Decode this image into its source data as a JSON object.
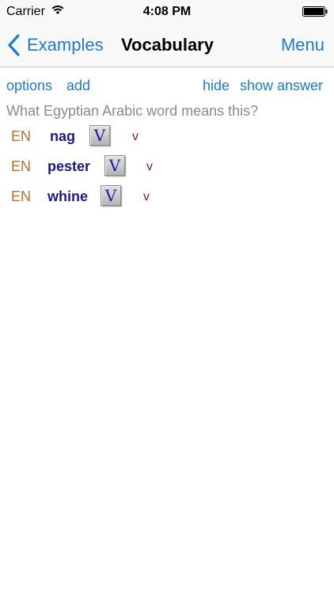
{
  "status_bar": {
    "carrier": "Carrier",
    "time": "4:08 PM"
  },
  "nav": {
    "back_label": "Examples",
    "title": "Vocabulary",
    "menu_label": "Menu"
  },
  "toolbar": {
    "options": "options",
    "add": "add",
    "hide": "hide",
    "show_answer": "show answer"
  },
  "question": "What Egyptian Arabic word means this?",
  "words": [
    {
      "lang": "EN",
      "word": "nag",
      "button": "V",
      "pos": "v"
    },
    {
      "lang": "EN",
      "word": "pester",
      "button": "V",
      "pos": "v"
    },
    {
      "lang": "EN",
      "word": "whine",
      "button": "V",
      "pos": "v"
    }
  ],
  "colors": {
    "accent": "#1a7bd6",
    "lang": "#c0702a",
    "word": "#1a1a8a",
    "pos": "#8b1a1a",
    "question": "#8a8a8a"
  }
}
